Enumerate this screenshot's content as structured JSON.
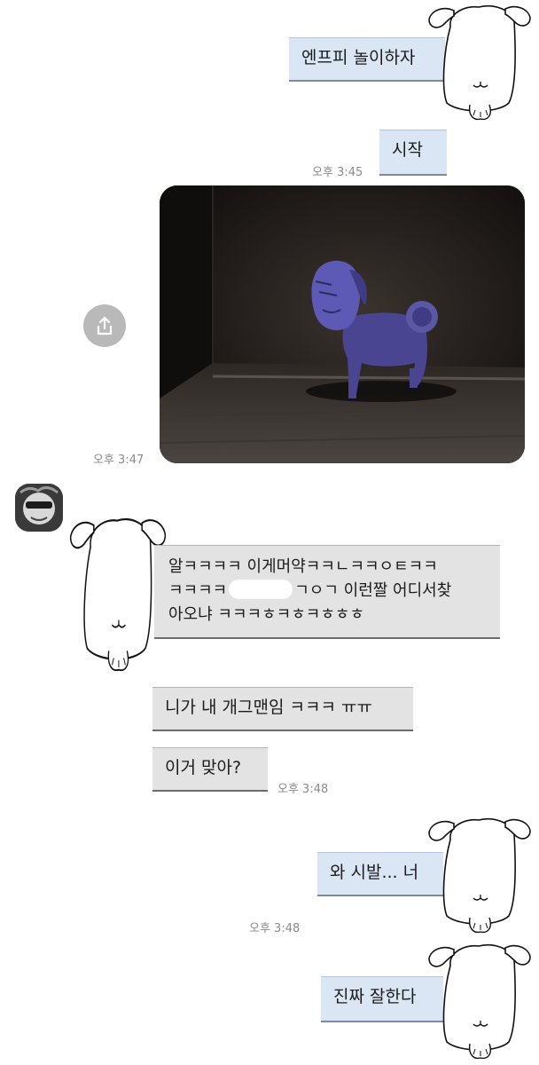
{
  "messages": {
    "m1": "엔프피 놀이하자",
    "m2": "시작",
    "m3_line1": "알ㅋㅋㅋㅋ 이게머약ㅋㅋㄴㅋㅋㅇㅌㅋㅋ",
    "m3_line2a": "ㅋㅋㅋㅋ",
    "m3_line2b": "ㄱㅇㄱ 이런짤 어디서찾",
    "m3_line3": "아오냐 ㅋㅋㅋㅎㅋㅎㅋㅎㅎㅎ",
    "m4": "니가 내 개그맨임 ㅋㅋㅋ ㅠㅠ",
    "m5": "이거 맞아?",
    "m6": "와 시발... 너",
    "m7": "진짜 잘한다"
  },
  "times": {
    "t1": "오후 3:45",
    "t2": "오후 3:47",
    "t3": "오후 3:48",
    "t4": "오후 3:48"
  },
  "icons": {
    "share": "share-icon",
    "dog": "dog-doodle-icon",
    "avatar": "avatar"
  },
  "colors": {
    "outgoing_bubble": "#dbe6f5",
    "incoming_bubble": "#e3e3e3",
    "timestamp": "#8a8a8a"
  }
}
